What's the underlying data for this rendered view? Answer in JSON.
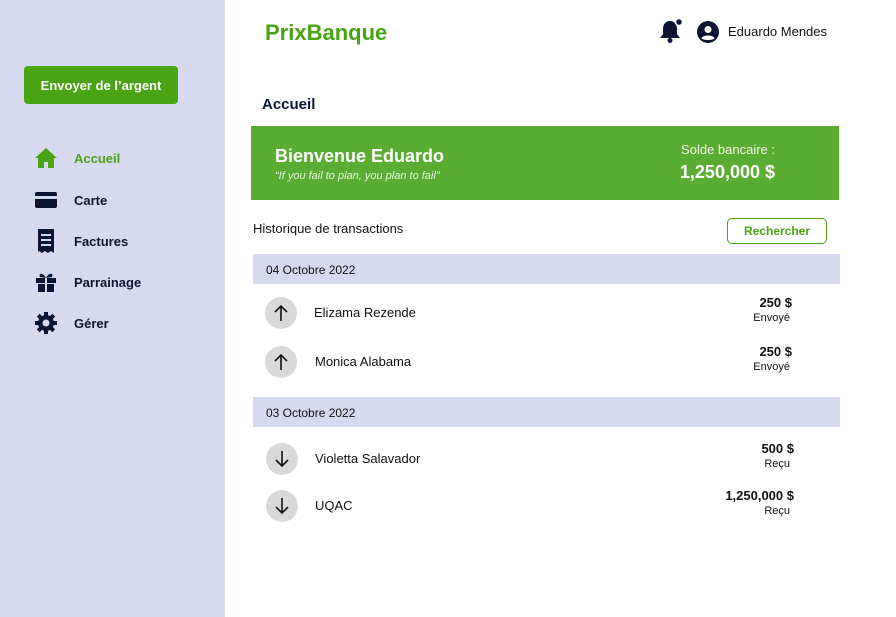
{
  "sidebar": {
    "send_button": "Envoyer de l’argent",
    "items": [
      {
        "label": "Accueil",
        "icon": "home-icon"
      },
      {
        "label": "Carte",
        "icon": "card-icon"
      },
      {
        "label": "Factures",
        "icon": "receipt-icon"
      },
      {
        "label": "Parrainage",
        "icon": "gift-icon"
      },
      {
        "label": "Gérer",
        "icon": "gear-icon"
      }
    ]
  },
  "header": {
    "brand": "PrixBanque",
    "user_name": "Eduardo Mendes"
  },
  "main": {
    "page_title": "Accueil",
    "banner": {
      "welcome": "Bienvenue Eduardo",
      "quote": "“If you fail to plan, you plan to fail”",
      "balance_label": "Solde bancaire :",
      "balance_value": "1,250,000 $"
    },
    "history_title": "Historique de transactions",
    "search_button": "Rechercher",
    "groups": [
      {
        "date": "04 Octobre 2022",
        "transactions": [
          {
            "name": "Elizama Rezende",
            "amount": "250 $",
            "status": "Envoyé",
            "direction": "up"
          },
          {
            "name": "Monica Alabama",
            "amount": "250 $",
            "status": "Envoyé",
            "direction": "up"
          }
        ]
      },
      {
        "date": "03 Octobre 2022",
        "transactions": [
          {
            "name": "Violetta Salavador",
            "amount": "500 $",
            "status": "Reçu",
            "direction": "down"
          },
          {
            "name": "UQAC",
            "amount": "1,250,000 $",
            "status": "Reçu",
            "direction": "down"
          }
        ]
      }
    ]
  },
  "colors": {
    "accent": "#4aa313",
    "banner": "#5aac33",
    "sidebar_bg": "#d7d9f0",
    "nav_text": "#0b1533"
  }
}
